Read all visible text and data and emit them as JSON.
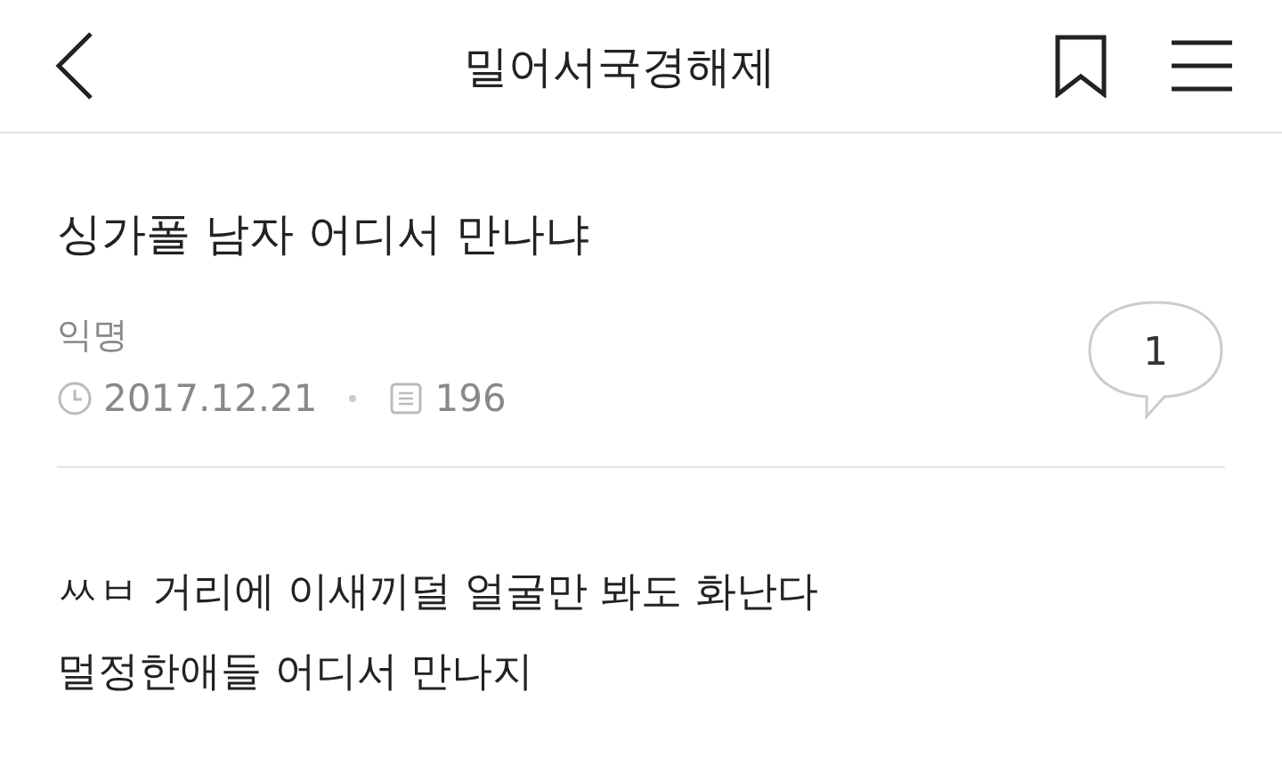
{
  "header": {
    "title": "밀어서국경해제"
  },
  "post": {
    "title": "싱가폴 남자 어디서 만나냐",
    "author": "익명",
    "date": "2017.12.21",
    "views": "196",
    "comments": "1"
  },
  "body": [
    "ㅆㅂ 거리에 이새끼덜 얼굴만 봐도 화난다",
    "멀정한애들 어디서 만나지"
  ]
}
